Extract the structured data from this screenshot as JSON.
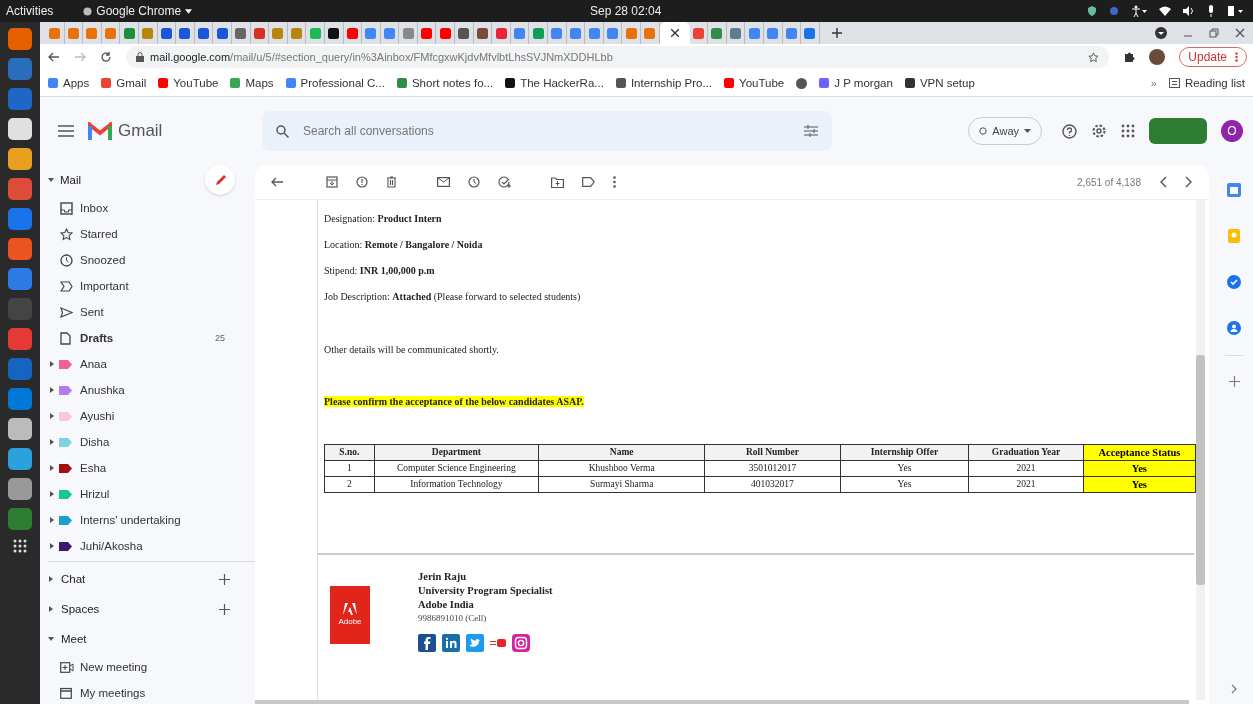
{
  "top_bar": {
    "activities": "Activities",
    "app_menu": "Google Chrome",
    "clock": "Sep 28  02:04"
  },
  "tabs": [
    {
      "color": "#e8710a",
      "selected": false
    },
    {
      "color": "#e8710a",
      "selected": false
    },
    {
      "color": "#e8710a",
      "selected": false
    },
    {
      "color": "#e8710a",
      "selected": false
    },
    {
      "color": "#1e8e3e",
      "selected": false
    },
    {
      "color": "#b8860b",
      "selected": false
    },
    {
      "color": "#1a56db",
      "selected": false
    },
    {
      "color": "#1a56db",
      "selected": false
    },
    {
      "color": "#1a56db",
      "selected": false
    },
    {
      "color": "#1a56db",
      "selected": false
    },
    {
      "color": "#666666",
      "selected": false
    },
    {
      "color": "#d93025",
      "selected": false
    },
    {
      "color": "#b8860b",
      "selected": false
    },
    {
      "color": "#b8860b",
      "selected": false
    },
    {
      "color": "#1db954",
      "selected": false
    },
    {
      "color": "#111111",
      "selected": false
    },
    {
      "color": "#ff0000",
      "selected": false
    },
    {
      "color": "#4285f4",
      "selected": false
    },
    {
      "color": "#4285f4",
      "selected": false
    },
    {
      "color": "#888888",
      "selected": false
    },
    {
      "color": "#ff0000",
      "selected": false
    },
    {
      "color": "#ff0000",
      "selected": false
    },
    {
      "color": "#555555",
      "selected": false
    },
    {
      "color": "#7a4a3a",
      "selected": false
    },
    {
      "color": "#e8233a",
      "selected": false
    },
    {
      "color": "#4285f4",
      "selected": false
    },
    {
      "color": "#0f9d58",
      "selected": false
    },
    {
      "color": "#4285f4",
      "selected": false
    },
    {
      "color": "#4285f4",
      "selected": false
    },
    {
      "color": "#4285f4",
      "selected": false
    },
    {
      "color": "#4285f4",
      "selected": false
    },
    {
      "color": "#e8710a",
      "selected": false
    },
    {
      "color": "#e8710a",
      "selected": false
    },
    {
      "selected": true
    },
    {
      "color": "#ea4335",
      "selected": false
    },
    {
      "color": "#2f8d46",
      "selected": false
    },
    {
      "color": "#607d8b",
      "selected": false
    },
    {
      "color": "#4285f4",
      "selected": false
    },
    {
      "color": "#4285f4",
      "selected": false
    },
    {
      "color": "#4285f4",
      "selected": false
    },
    {
      "color": "#1a73e8",
      "selected": false
    }
  ],
  "address_bar": {
    "host": "mail.google.com",
    "path": "/mail/u/5/#section_query/in%3Ainbox/FMfcgxwKjdvMfvlbtLhsSVJNmXDDHLbb",
    "update_button": "Update"
  },
  "bookmarks": [
    {
      "label": "Apps",
      "color": "#4285f4"
    },
    {
      "label": "Gmail",
      "color": "#ea4335"
    },
    {
      "label": "YouTube",
      "color": "#ff0000"
    },
    {
      "label": "Maps",
      "color": "#34a853"
    },
    {
      "label": "Professional C...",
      "color": "#4285f4"
    },
    {
      "label": "Short notes fo...",
      "color": "#2f8d46"
    },
    {
      "label": "The HackerRa...",
      "color": "#111111"
    },
    {
      "label": "Internship Pro...",
      "color": "#555555"
    },
    {
      "label": "YouTube",
      "color": "#ff0000"
    },
    {
      "color": "#555555"
    },
    {
      "label": "J P morgan",
      "color": "#6c63ff"
    },
    {
      "label": "VPN setup",
      "color": "#333333"
    }
  ],
  "bookmarks_more": "»",
  "reading_list": "Reading list",
  "gmail": {
    "logo_text": "Gmail",
    "search_placeholder": "Search all conversations",
    "status": "Away",
    "avatar_letter": "O"
  },
  "sidebar": {
    "mail_heading": "Mail",
    "items": [
      {
        "kind": "inbox",
        "label": "Inbox",
        "bold": false
      },
      {
        "kind": "starred",
        "label": "Starred",
        "bold": false
      },
      {
        "kind": "snoozed",
        "label": "Snoozed",
        "bold": false
      },
      {
        "kind": "important",
        "label": "Important",
        "bold": false
      },
      {
        "kind": "sent",
        "label": "Sent",
        "bold": false
      },
      {
        "kind": "drafts",
        "label": "Drafts",
        "bold": true,
        "count": "25"
      },
      {
        "kind": "label",
        "label": "Anaa",
        "color": "#f06292",
        "bold": false
      },
      {
        "kind": "label",
        "label": "Anushka",
        "color": "#b57bee",
        "bold": false
      },
      {
        "kind": "label",
        "label": "Ayushi",
        "color": "#f8c8d8",
        "bold": false
      },
      {
        "kind": "label",
        "label": "Disha",
        "color": "#7fd3e0",
        "bold": false
      },
      {
        "kind": "label",
        "label": "Esha",
        "color": "#a50e0e",
        "bold": false
      },
      {
        "kind": "label",
        "label": "Hrizul",
        "color": "#16c98d",
        "bold": false
      },
      {
        "kind": "label",
        "label": "Interns' undertaking",
        "color": "#1ba1c9",
        "bold": false
      },
      {
        "kind": "label",
        "label": "Juhi/Akosha",
        "color": "#3d1a6e",
        "bold": false
      }
    ],
    "sections": [
      {
        "label": "Chat",
        "expanded": false
      },
      {
        "label": "Spaces",
        "expanded": false
      },
      {
        "label": "Meet",
        "expanded": true
      }
    ],
    "meet_items": [
      {
        "kind": "new",
        "label": "New meeting"
      },
      {
        "kind": "calendar",
        "label": "My meetings"
      }
    ]
  },
  "toolbar": {
    "count": "2,651 of 4,138"
  },
  "email": {
    "lines": [
      {
        "kind": "text",
        "text": "Designation: **Product Intern**"
      },
      {
        "kind": "text",
        "text": "Location: **Remote / Bangalore / Noida**"
      },
      {
        "kind": "text",
        "text": "Stipend: **INR 1,00,000 p.m**"
      },
      {
        "kind": "text",
        "text": "Job Description: **Attached** (Please forward to selected students)"
      },
      {
        "kind": "gap",
        "text": "Other details will be communicated shortly."
      },
      {
        "kind": "highlight",
        "text": "Please confirm the acceptance of the below candidates ASAP."
      }
    ],
    "table": {
      "columns": [
        {
          "label": "S.no.",
          "highlighted": false
        },
        {
          "label": "Department",
          "highlighted": false
        },
        {
          "label": "Name",
          "highlighted": false
        },
        {
          "label": "Roll Number",
          "highlighted": false
        },
        {
          "label": "Internship Offer",
          "highlighted": false
        },
        {
          "label": "Graduation Year",
          "highlighted": false
        },
        {
          "label": "Acceptance Status",
          "highlighted": true
        }
      ],
      "rows": [
        [
          "1",
          "Computer Science Engineering",
          "Khushboo Verma",
          "3501012017",
          "Yes",
          "2021",
          "Yes"
        ],
        [
          "2",
          "Information Technology",
          "Surmayi Sharma",
          "401032017",
          "Yes",
          "2021",
          "Yes"
        ]
      ]
    },
    "signature": {
      "logo_text": "Adobe",
      "name": "Jerin Raju",
      "title": "University Program Specialist",
      "company": "Adobe India",
      "phone": "9986891010 (Cell)"
    }
  }
}
